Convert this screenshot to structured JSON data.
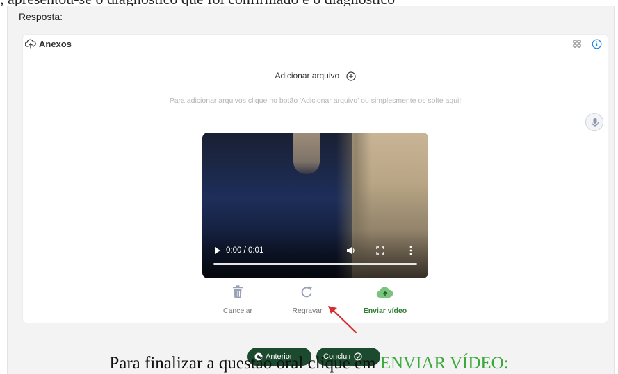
{
  "top_text": ", apresentou-se o diagnóstico que foi confirmado e o diagnóstico",
  "labels": {
    "resposta": "Resposta:",
    "anexos": "Anexos",
    "add_file": "Adicionar arquivo",
    "hint": "Para adicionar arquivos clique no botão 'Adicionar arquivo' ou simplesmente os solte aqui!"
  },
  "video": {
    "time": "0:00 / 0:01",
    "progress": 0
  },
  "actions": {
    "cancel": "Cancelar",
    "redo": "Regravar",
    "send": "Enviar vídeo"
  },
  "nav": {
    "prev": "Anterior",
    "done": "Concluir"
  },
  "caption": {
    "before": "Para finalizar a questão oral clique em ",
    "highlight": "ENVIAR VÍDEO:"
  },
  "colors": {
    "accent_green": "#2e7d32",
    "button_dark_green": "#1c4a2e",
    "info_blue": "#1e88e5",
    "arrow_red": "#d32f2f"
  },
  "icons": [
    "cloud-upload-icon",
    "grid-icon",
    "info-icon",
    "plus-circle-icon",
    "microphone-icon",
    "play-icon",
    "volume-icon",
    "fullscreen-icon",
    "more-vertical-icon",
    "trash-icon",
    "redo-icon",
    "cloud-upload-green-icon",
    "arrow-left-circle-icon",
    "check-circle-icon"
  ]
}
